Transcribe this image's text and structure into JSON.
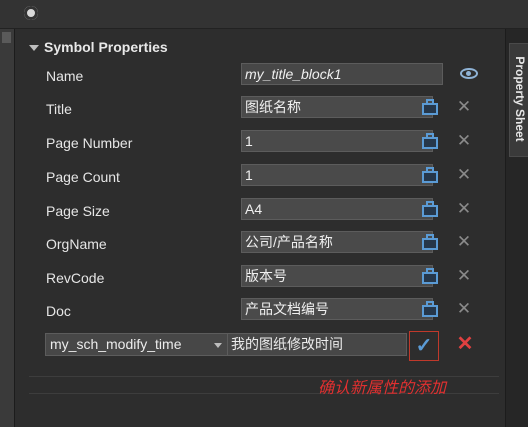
{
  "section": {
    "title": "Symbol Properties"
  },
  "properties": [
    {
      "label": "Name",
      "value": "my_title_block1"
    },
    {
      "label": "Title",
      "value": "图纸名称"
    },
    {
      "label": "Page Number",
      "value": "1"
    },
    {
      "label": "Page Count",
      "value": "1"
    },
    {
      "label": "Page Size",
      "value": "A4"
    },
    {
      "label": "OrgName",
      "value": "公司/产品名称"
    },
    {
      "label": "RevCode",
      "value": "版本号"
    },
    {
      "label": "Doc",
      "value": "产品文档编号"
    }
  ],
  "new_property": {
    "name_selected": "my_sch_modify_time",
    "value": "我的图纸修改时间",
    "confirm_icon": "✓",
    "cancel_icon": "✕"
  },
  "annotation": "确认新属性的添加",
  "sidebar_tab": "Property Sheet",
  "icons": {
    "clear": "✕"
  },
  "colors": {
    "accent": "#5b9bd5",
    "annotation": "#e03030",
    "confirm_border": "#c0392b"
  }
}
